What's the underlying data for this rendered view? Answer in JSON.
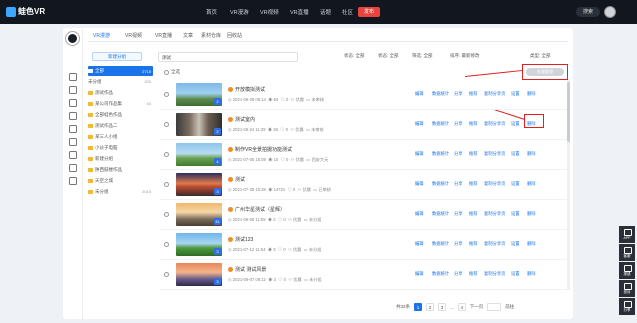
{
  "brand": {
    "name": "蛙色VR"
  },
  "nav": [
    "首页",
    "VR漫游",
    "VR视频",
    "VR直播",
    "话题",
    "社区"
  ],
  "publish_label": "发布",
  "search_label": "搜索",
  "tabs": [
    {
      "label": "VR漫游",
      "active": true
    },
    {
      "label": "VR视频",
      "active": false
    },
    {
      "label": "VR直播",
      "active": false
    },
    {
      "label": "文章",
      "active": false
    },
    {
      "label": "素材仓库",
      "active": false
    },
    {
      "label": "回收站",
      "active": false
    }
  ],
  "new_folder_label": "新建分组",
  "folders": [
    {
      "name": "全部",
      "count": "2715",
      "active": true
    },
    {
      "name": "未分组",
      "count": "205",
      "active": false
    },
    {
      "name": "测试作品",
      "count": "",
      "active": false
    },
    {
      "name": "某公司作品集",
      "count": "44",
      "active": false
    },
    {
      "name": "全部蛙色作品",
      "count": "",
      "active": false
    },
    {
      "name": "测试作品二",
      "count": "",
      "active": false
    },
    {
      "name": "某三人小组",
      "count": "",
      "active": false
    },
    {
      "name": "小伙子电脑",
      "count": "",
      "active": false
    },
    {
      "name": "新建分组",
      "count": "",
      "active": false
    },
    {
      "name": "陕西鼓楼作品",
      "count": "",
      "active": false
    },
    {
      "name": "天空之城",
      "count": "",
      "active": false
    },
    {
      "name": "未分组",
      "count": "2015",
      "active": false
    }
  ],
  "search_value": "测试",
  "filters": [
    "状态: 全部",
    "状态: 全部",
    "筛选: 全部",
    "排序: 最新修改",
    "类型: 全部"
  ],
  "select_all_label": "全选",
  "batch_label": "批量管理",
  "actions": [
    "编辑",
    "数据统计",
    "分享",
    "推荐",
    "复制分享页",
    "设置",
    "删除"
  ],
  "rows": [
    {
      "title": "开放模拟测试",
      "date": "2021-06-28 09:14",
      "views": "64",
      "likes": "0",
      "owner": "伏晨",
      "status": "未审核",
      "badge": "2",
      "tone": "sky"
    },
    {
      "title": "测试室内",
      "date": "2021-06-24 11:29",
      "views": "36",
      "likes": "0",
      "owner": "伏晨",
      "status": "未审核",
      "badge": "2",
      "tone": "room"
    },
    {
      "title": "制作VR全景拍摄功能测试",
      "date": "2021-07-05 15:59",
      "views": "10",
      "likes": "0",
      "owner": "伏晨",
      "status": "西安大元",
      "badge": "4",
      "tone": "field"
    },
    {
      "title": "测试",
      "date": "2021-07-28 15:26",
      "views": "14721",
      "likes": "0",
      "owner": "伏晨",
      "status": "已审核",
      "badge": "3",
      "tone": "sunset"
    },
    {
      "title": "广州华星测试（星辉）",
      "date": "2021-06-08 11:09",
      "views": "2",
      "likes": "0",
      "owner": "伏晨",
      "status": "未分组",
      "badge": "31",
      "tone": "plaza"
    },
    {
      "title": "测试123",
      "date": "2021-07-12 11:54",
      "views": "3",
      "likes": "0",
      "owner": "伏晨",
      "status": "未分组",
      "badge": "3",
      "tone": "park"
    },
    {
      "title": "测试 测试风景",
      "date": "2021-06-07 09:12",
      "views": "3",
      "likes": "0",
      "owner": "伏晨",
      "status": "未分组",
      "badge": "3",
      "tone": "sunset2"
    }
  ],
  "pager": {
    "total": "共32条",
    "pages": [
      "1",
      "2",
      "3",
      "...",
      "4"
    ],
    "next": "下一页",
    "jump": "前往"
  },
  "side_tools": [
    "APP",
    "客服",
    "报错",
    "投诉",
    "分享",
    "返回"
  ]
}
